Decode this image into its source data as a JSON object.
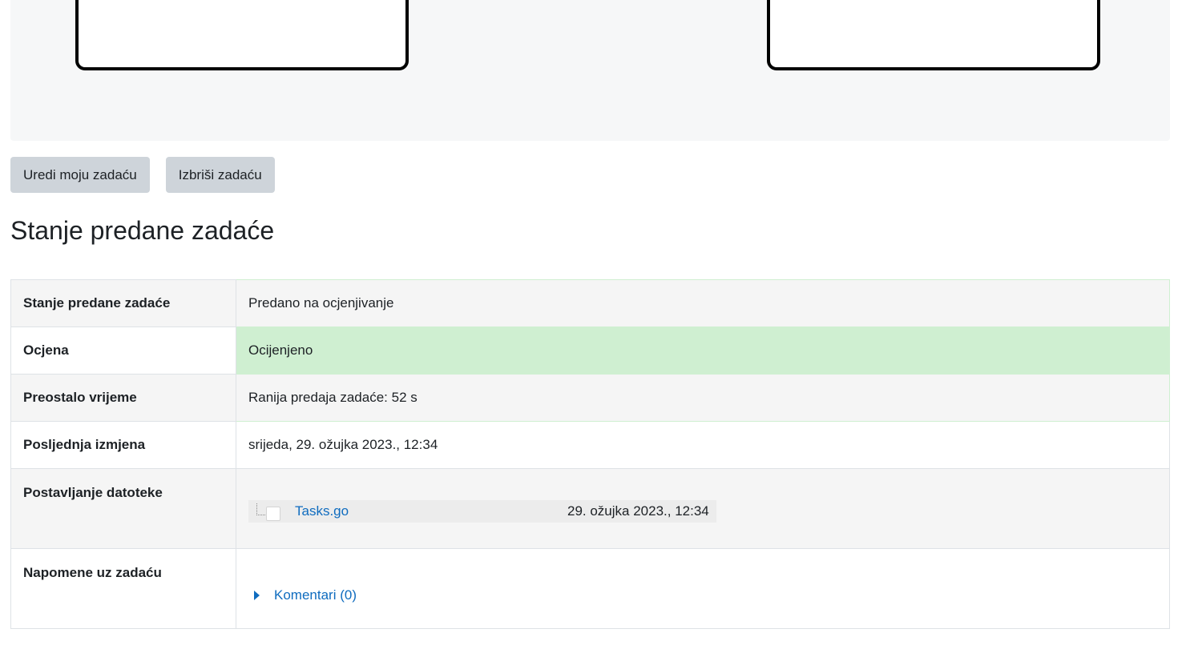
{
  "actions": {
    "edit_label": "Uredi moju zadaću",
    "delete_label": "Izbriši zadaću"
  },
  "section": {
    "title": "Stanje predane zadaće"
  },
  "status": {
    "submission_status": {
      "label": "Stanje predane zadaće",
      "value": "Predano na ocjenjivanje"
    },
    "grade": {
      "label": "Ocjena",
      "value": "Ocijenjeno"
    },
    "time_remaining": {
      "label": "Preostalo vrijeme",
      "value": "Ranija predaja zadaće: 52 s"
    },
    "last_modified": {
      "label": "Posljednja izmjena",
      "value": "srijeda, 29. ožujka 2023., 12:34"
    },
    "file_upload": {
      "label": "Postavljanje datoteke",
      "file_name": "Tasks.go",
      "file_date": "29. ožujka 2023., 12:34"
    },
    "comments": {
      "label": "Napomene uz zadaću",
      "link_text": "Komentari (0)"
    }
  },
  "colors": {
    "success_bg": "#cfefd1",
    "link": "#0f6cbf",
    "button_bg": "#ced4da"
  },
  "icons": {
    "file": "document-icon",
    "expand": "caret-right-icon"
  }
}
